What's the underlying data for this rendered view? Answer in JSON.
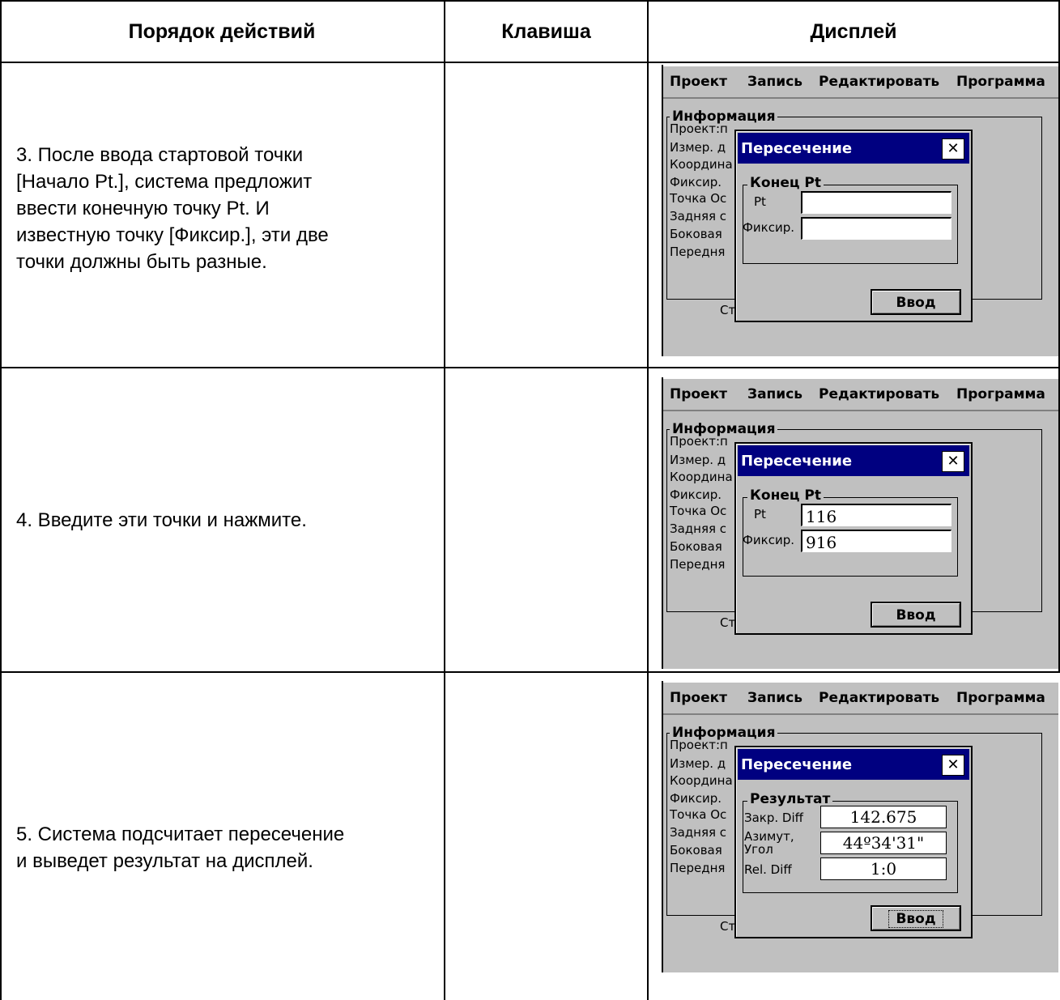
{
  "table": {
    "headers": [
      "Порядок действий",
      "Клавиша",
      "Дисплей"
    ],
    "rows": [
      {
        "step_lines": [
          "3. После ввода стартовой точки",
          "[Начало Pt.], система предложит",
          "ввести конечную точку  Pt. И",
          "известную точку [Фиксир.], эти две",
          "точки должны быть разные."
        ],
        "key": ""
      },
      {
        "step_lines": [
          "4. Введите эти точки и нажмите."
        ],
        "key": ""
      },
      {
        "step_lines": [
          "5. Система подсчитает пересечение",
          "и выведет результат на дисплей."
        ],
        "key": ""
      }
    ]
  },
  "device": {
    "menu": [
      "Проект",
      "Запись",
      "Редактировать",
      "Программа"
    ],
    "info_group_title": "Информация",
    "bg_lines": [
      "Проект:п",
      "Измер. д",
      "Координа",
      "Фиксир.",
      "Точка Ос",
      "Задняя с",
      "Боковая",
      "Передня"
    ],
    "bottom_fragment": "Ст",
    "dialog_title": "Пересечение",
    "close_glyph": "✕",
    "end_group_title": "Конец Pt",
    "pt_label": "Pt",
    "fix_label": "Фиксир.",
    "enter_button": "Ввод",
    "screen2_values": {
      "pt": "116",
      "fix": "916"
    },
    "result_group_title": "Результат",
    "results": [
      {
        "label": "Закр. Diff",
        "value": "142.675"
      },
      {
        "label": "Азимут,",
        "label2": "Угол",
        "value": "44º34'31\""
      },
      {
        "label": "Rel. Diff",
        "value": "1:0"
      }
    ]
  }
}
